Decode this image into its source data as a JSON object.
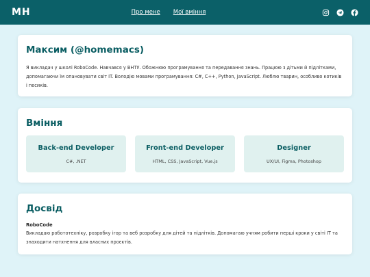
{
  "header": {
    "logo": "МН",
    "nav": [
      "Про мене",
      "Мої вміння"
    ],
    "socials": [
      "instagram-icon",
      "telegram-icon",
      "facebook-icon"
    ]
  },
  "about": {
    "name": "Максим (@homemacs)",
    "text": "Я викладач у школі RoboCode. Навчався у ВНТУ. Обожнюю програмування та передавання знань. Працюю з дітьми й підлітками, допомагаючи їм опановувати світ IT. Володію мовами програмування: C#, C++, Python, JavaScript. Люблю тварин, особливо котиків і песиків."
  },
  "skills": {
    "title": "Вміння",
    "items": [
      {
        "title": "Back-end Developer",
        "desc": "C#, .NET"
      },
      {
        "title": "Front-end Developer",
        "desc": "HTML, CSS, JavaScript, Vue.js"
      },
      {
        "title": "Designer",
        "desc": "UX/UI, Figma, Photoshop"
      }
    ]
  },
  "experience": {
    "title": "Досвід",
    "company": "RoboCode",
    "text": "Викладаю робототехніку, розробку ігор та веб розробку для дітей та підлітків. Допомагаю учням робити перші кроки у світі IT та знаходити натхнення для власних проєктів."
  },
  "colors": {
    "header_bg": "#0b6068",
    "accent": "#0b5e63",
    "page_bg": "#dff3f8",
    "skill_bg": "#e0f1ef"
  }
}
